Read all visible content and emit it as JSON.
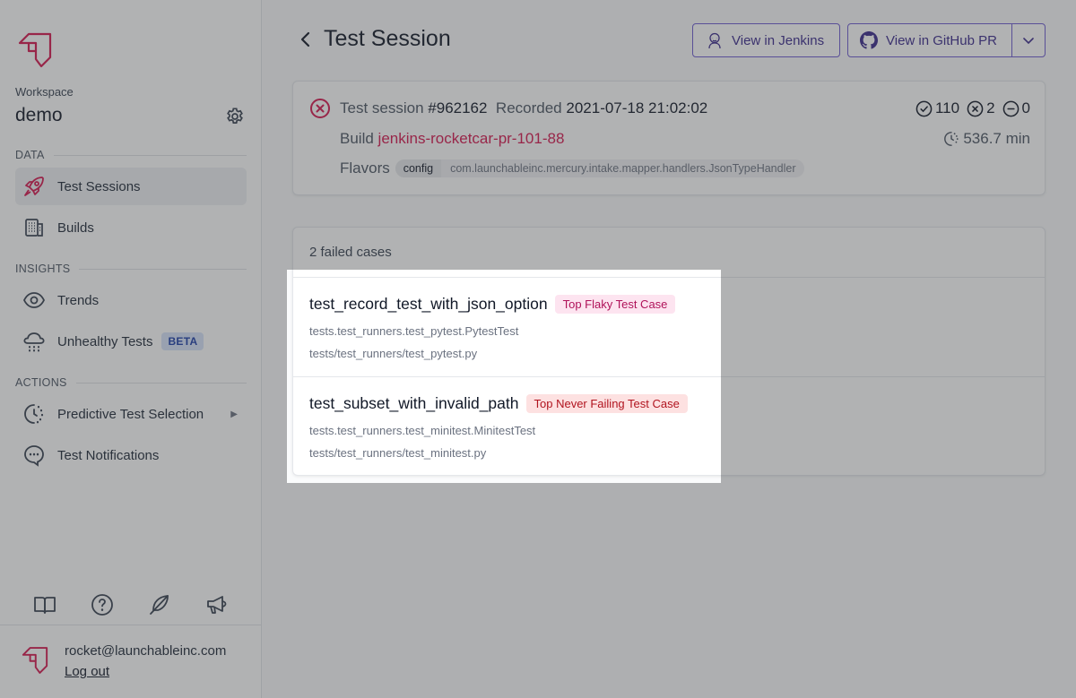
{
  "sidebar": {
    "workspace_label": "Workspace",
    "workspace_name": "demo",
    "sections": {
      "data": "DATA",
      "insights": "INSIGHTS",
      "actions": "ACTIONS"
    },
    "items": [
      {
        "label": "Test Sessions",
        "icon": "rocket-icon",
        "active": true
      },
      {
        "label": "Builds",
        "icon": "building-icon"
      },
      {
        "label": "Trends",
        "icon": "eye-icon"
      },
      {
        "label": "Unhealthy Tests",
        "icon": "cloud-rain-icon",
        "badge": "BETA"
      },
      {
        "label": "Predictive Test Selection",
        "icon": "clock-dashed-icon",
        "caret": "▶"
      },
      {
        "label": "Test Notifications",
        "icon": "chat-bubble-icon"
      }
    ],
    "footer_icons": [
      "book-icon",
      "help-icon",
      "feather-icon",
      "megaphone-icon"
    ],
    "user_email": "rocket@launchableinc.com",
    "logout_label": "Log out"
  },
  "header": {
    "title": "Test Session",
    "jenkins_button": "View in Jenkins",
    "github_button": "View in GitHub PR"
  },
  "session": {
    "label": "Test session",
    "id": "#962162",
    "recorded_label": "Recorded",
    "recorded_at": "2021-07-18 21:02:02",
    "build_label": "Build",
    "build_name": "jenkins-rocketcar-pr-101-88",
    "flavors_label": "Flavors",
    "flavor_key": "config",
    "flavor_value": "com.launchableinc.mercury.intake.mapper.handlers.JsonTypeHandler",
    "passed": "110",
    "failed": "2",
    "skipped": "0",
    "duration": "536.7 min",
    "status": "failed",
    "colors": {
      "accent": "#d6174f",
      "button": "#6d5bd0"
    }
  },
  "cases": {
    "header": "2 failed cases",
    "rows": [
      {
        "name": "test_record_test_with_json_option",
        "badge": "Top Flaky Test Case",
        "class": "tests.test_runners.test_pytest.PytestTest",
        "file": "tests/test_runners/test_pytest.py"
      },
      {
        "name": "test_subset_with_invalid_path",
        "badge": "Top Never Failing Test Case",
        "class": "tests.test_runners.test_minitest.MinitestTest",
        "file": "tests/test_runners/test_minitest.py"
      }
    ]
  }
}
